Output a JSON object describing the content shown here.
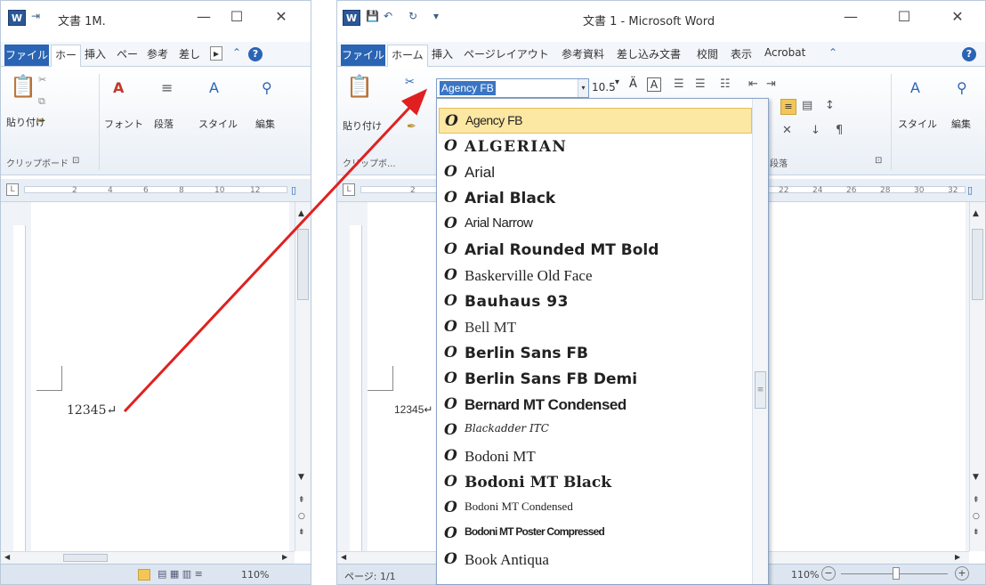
{
  "left_window": {
    "title": "文書 1M.",
    "file_tab": "ファイル",
    "tabs": [
      "ホー",
      "挿入",
      "ペー",
      "参考",
      "差し"
    ],
    "ribbon": {
      "paste": "貼り付け",
      "font": "フォント",
      "paragraph": "段落",
      "style": "スタイル",
      "editing": "編集",
      "clipboard_group": "クリップボード",
      "clipboard_launcher": "⊡"
    },
    "ruler_ticks": [
      "2",
      "4",
      "6",
      "8",
      "10",
      "12"
    ],
    "doc_text": "12345↵",
    "zoom": "110%"
  },
  "right_window": {
    "title": "文書 1 - Microsoft Word",
    "file_tab": "ファイル",
    "tabs": [
      "ホーム",
      "挿入",
      "ページレイアウト",
      "参考資料",
      "差し込み文書",
      "校閲",
      "表示",
      "Acrobat"
    ],
    "ribbon": {
      "paste": "貼り付け",
      "font_size": "10.5",
      "style": "スタイル",
      "editing": "編集",
      "clipboard_group": "クリップボ...",
      "paragraph_group": "段落"
    },
    "ruler_ticks": [
      "2",
      "22",
      "24",
      "26",
      "28",
      "30",
      "32"
    ],
    "doc_text": "12345↵",
    "status_page": "ページ: 1/1",
    "zoom": "110%",
    "font_box_value": "Agency FB"
  },
  "font_list": {
    "items": [
      {
        "name": "Agency FB",
        "selected": true
      },
      {
        "name": "ALGERIAN",
        "selected": false
      },
      {
        "name": "Arial",
        "selected": false
      },
      {
        "name": "Arial Black",
        "selected": false
      },
      {
        "name": "Arial Narrow",
        "selected": false
      },
      {
        "name": "Arial Rounded MT Bold",
        "selected": false
      },
      {
        "name": "Baskerville Old Face",
        "selected": false
      },
      {
        "name": "Bauhaus 93",
        "selected": false
      },
      {
        "name": "Bell MT",
        "selected": false
      },
      {
        "name": "Berlin Sans FB",
        "selected": false
      },
      {
        "name": "Berlin Sans FB Demi",
        "selected": false
      },
      {
        "name": "Bernard MT Condensed",
        "selected": false
      },
      {
        "name": "Blackadder ITC",
        "selected": false
      },
      {
        "name": "Bodoni MT",
        "selected": false
      },
      {
        "name": "Bodoni MT Black",
        "selected": false
      },
      {
        "name": "Bodoni MT Condensed",
        "selected": false
      },
      {
        "name": "Bodoni MT Poster Compressed",
        "selected": false
      },
      {
        "name": "Book Antiqua",
        "selected": false
      }
    ],
    "glyph": "O"
  },
  "colors": {
    "accent_blue": "#2a64b4",
    "selection_yellow": "#fce7a3",
    "annotation_arrow": "#e02020"
  }
}
